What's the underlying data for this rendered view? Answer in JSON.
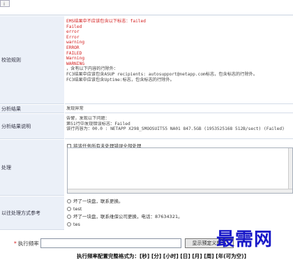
{
  "top_marker": "i",
  "rules": {
    "label": "校验规则",
    "lines": [
      {
        "text": "EMS结果中不应该包含以下标志：failed",
        "color": "red"
      },
      {
        "text": "Failed",
        "color": "red"
      },
      {
        "text": "error",
        "color": "red"
      },
      {
        "text": "Error",
        "color": "red"
      },
      {
        "text": "warning",
        "color": "red"
      },
      {
        "text": "ERROR",
        "color": "red"
      },
      {
        "text": "FAILED",
        "color": "red"
      },
      {
        "text": "Warning",
        "color": "red"
      },
      {
        "text": "WARNING",
        "color": "red"
      },
      {
        "text": "，含有以下内容的行除外：",
        "color": "dark"
      },
      {
        "text": "FC3结果中应该包含ASUP recipients: autosupport@netapp.com标志，包含标志的行除外。",
        "color": "dark"
      },
      {
        "text": "FC3结果中应该包含Uptime:标志，包含标志的行除外。",
        "color": "dark"
      }
    ]
  },
  "result": {
    "label": "分析结果",
    "value": "发现异常"
  },
  "detail": {
    "label": "分析结果说明",
    "lines": [
      "告警，发现以下问题：",
      "第51行中发现错误标志：Failed",
      "该行内容为：00.0 : NETAPP   X298_SMOOSUIT55 NA01 847.5GB (1953525168 512B/sect) (Failed)"
    ]
  },
  "handling": {
    "label": "处理",
    "checkbox_label": "将该任务所有未处理错误全部处理"
  },
  "reference": {
    "label": "以往处理方式参考",
    "options": [
      {
        "text": "坏了一块盘，联系更换。"
      },
      {
        "text": "test"
      },
      {
        "text": "坏了一块盘，联系维保公司更换，电话：87634321。"
      },
      {
        "text": "tes"
      }
    ]
  },
  "frequency": {
    "label": "执行频率",
    "required_mark": "*",
    "value": "",
    "button": "显示预定义频率",
    "format_text": "执行频率配置完整格式为：[秒] [分] [小时] [日] [月] [周] [年(可为空)]"
  },
  "watermark": "最需网"
}
